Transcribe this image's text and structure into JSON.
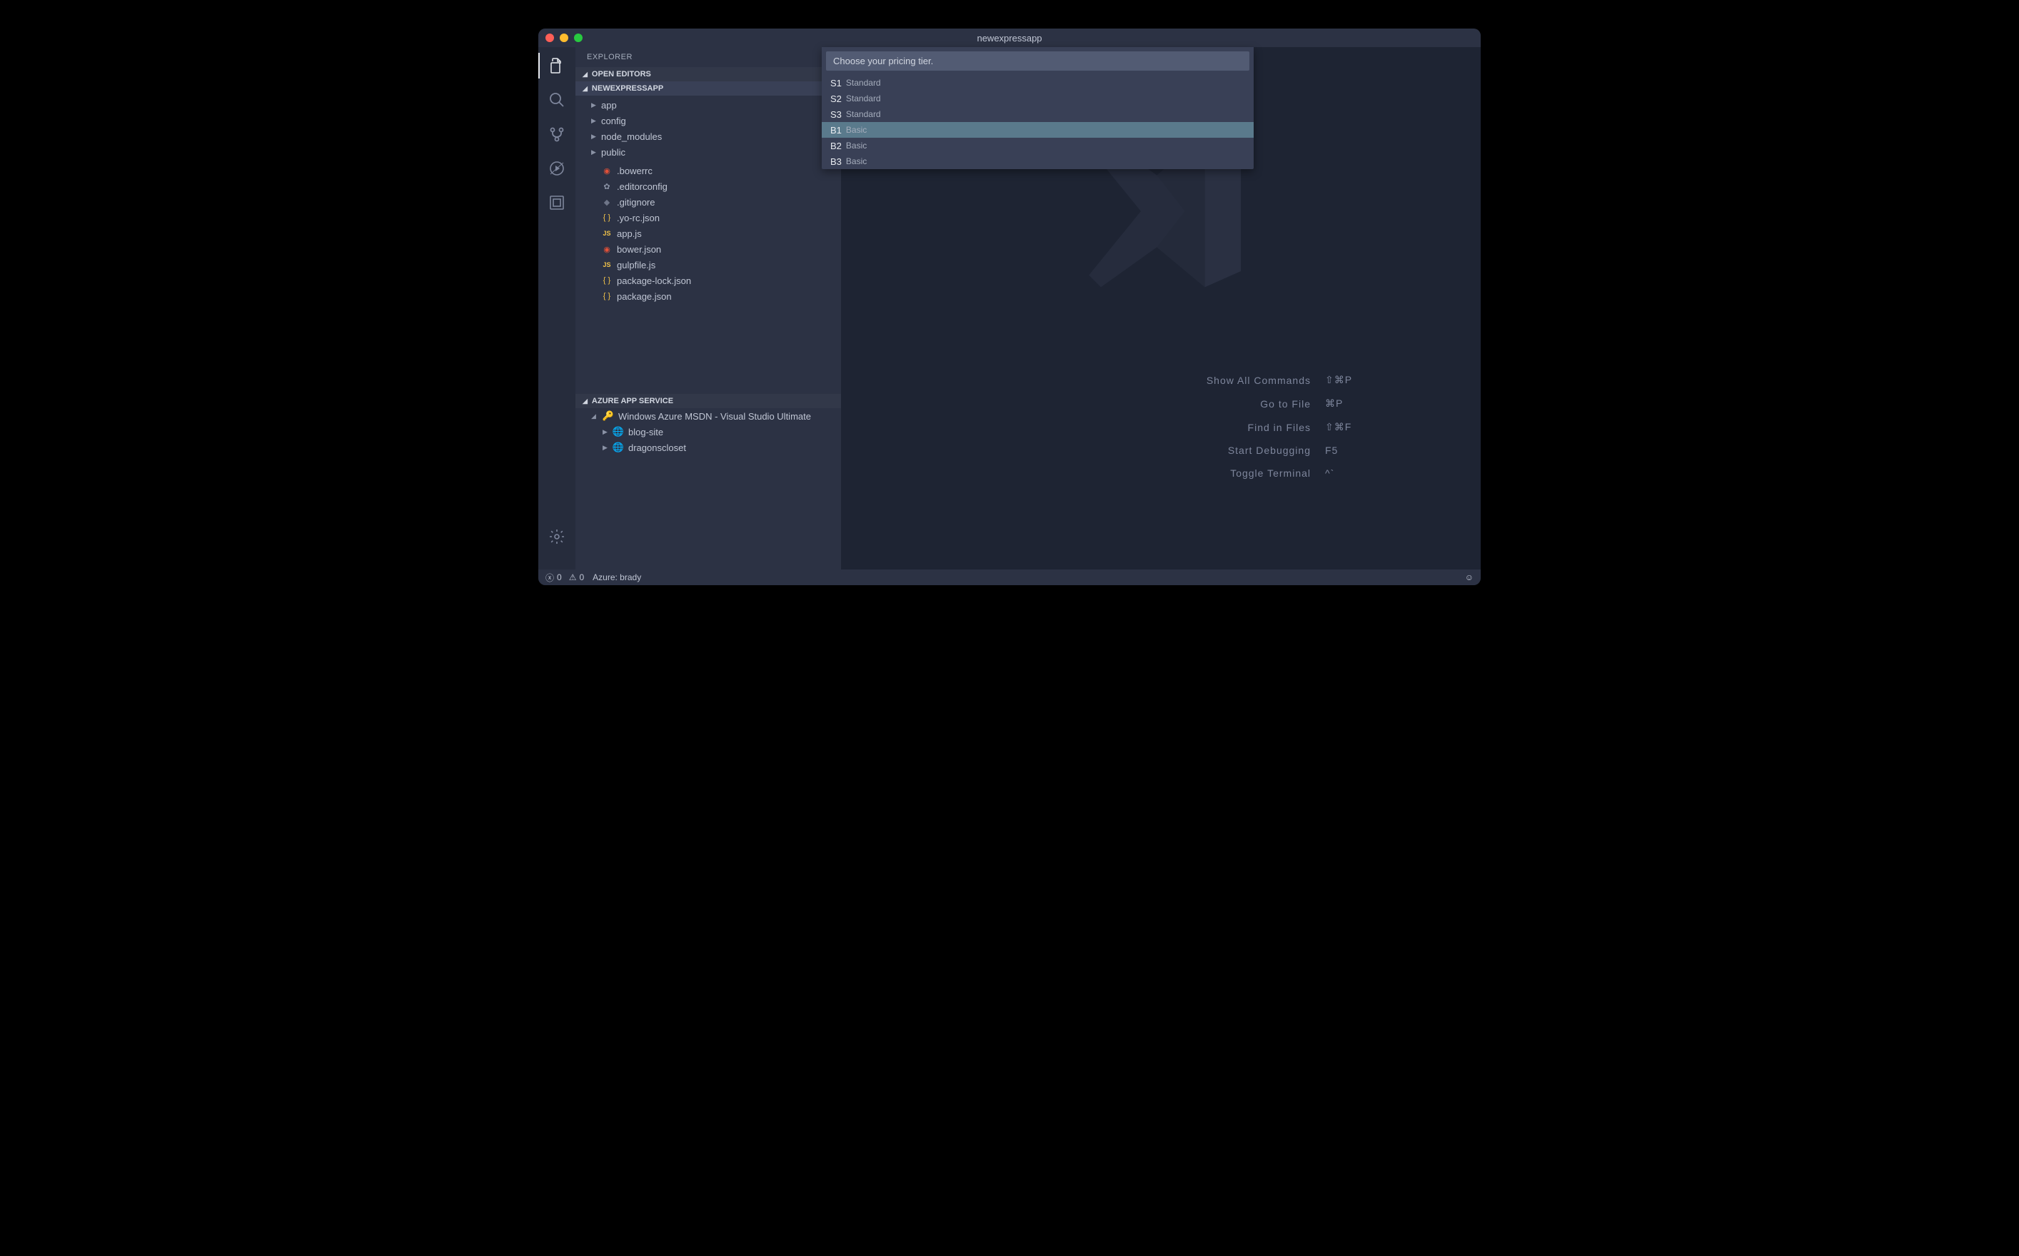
{
  "title": "newexpressapp",
  "sidebar": {
    "title": "EXPLORER",
    "open_editors": "OPEN EDITORS",
    "project_name": "NEWEXPRESSAPP",
    "folders": [
      {
        "label": "app",
        "expanded": false
      },
      {
        "label": "config",
        "expanded": false
      },
      {
        "label": "node_modules",
        "expanded": false
      },
      {
        "label": "public",
        "expanded": false
      }
    ],
    "files": [
      {
        "label": ".bowerrc",
        "icon": "bower"
      },
      {
        "label": ".editorconfig",
        "icon": "cfg"
      },
      {
        "label": ".gitignore",
        "icon": "git"
      },
      {
        "label": ".yo-rc.json",
        "icon": "json"
      },
      {
        "label": "app.js",
        "icon": "js"
      },
      {
        "label": "bower.json",
        "icon": "bower"
      },
      {
        "label": "gulpfile.js",
        "icon": "js"
      },
      {
        "label": "package-lock.json",
        "icon": "json"
      },
      {
        "label": "package.json",
        "icon": "json"
      }
    ],
    "azure_header": "AZURE APP SERVICE",
    "azure_subscription": "Windows Azure MSDN - Visual Studio Ultimate",
    "azure_apps": [
      {
        "label": "blog-site"
      },
      {
        "label": "dragonscloset"
      }
    ]
  },
  "quickpick": {
    "placeholder": "Choose your pricing tier.",
    "items": [
      {
        "code": "S1",
        "tier": "Standard",
        "selected": false
      },
      {
        "code": "S2",
        "tier": "Standard",
        "selected": false
      },
      {
        "code": "S3",
        "tier": "Standard",
        "selected": false
      },
      {
        "code": "B1",
        "tier": "Basic",
        "selected": true
      },
      {
        "code": "B2",
        "tier": "Basic",
        "selected": false
      },
      {
        "code": "B3",
        "tier": "Basic",
        "selected": false
      }
    ]
  },
  "welcome": [
    {
      "label": "Show All Commands",
      "key": "⇧⌘P"
    },
    {
      "label": "Go to File",
      "key": "⌘P"
    },
    {
      "label": "Find in Files",
      "key": "⇧⌘F"
    },
    {
      "label": "Start Debugging",
      "key": "F5"
    },
    {
      "label": "Toggle Terminal",
      "key": "^`"
    }
  ],
  "statusbar": {
    "errors": "0",
    "warnings": "0",
    "azure": "Azure: brady"
  }
}
